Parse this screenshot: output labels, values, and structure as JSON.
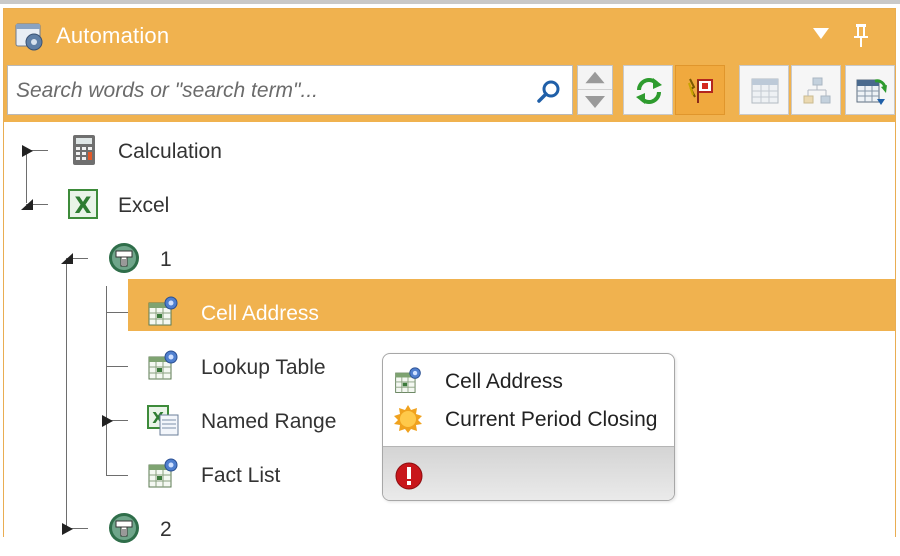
{
  "panel": {
    "title": "Automation"
  },
  "search": {
    "placeholder": "Search words or \"search term\"..."
  },
  "toolbar": {
    "buttons": [
      {
        "icon": "refresh-icon",
        "state": "normal"
      },
      {
        "icon": "flag-filter-icon",
        "state": "active"
      },
      {
        "icon": "table-grid-icon",
        "state": "disabled"
      },
      {
        "icon": "hierarchy-icon",
        "state": "disabled"
      },
      {
        "icon": "table-export-icon",
        "state": "normal"
      }
    ]
  },
  "tree": {
    "nodes": [
      {
        "label": "Calculation",
        "icon": "calculator-icon",
        "level": 0,
        "expanded": false
      },
      {
        "label": "Excel",
        "icon": "excel-icon",
        "level": 0,
        "expanded": true
      },
      {
        "label": "1",
        "icon": "connector-icon",
        "level": 1,
        "expanded": true
      },
      {
        "label": "Cell Address",
        "icon": "cell-address-icon",
        "level": 2,
        "selected": true
      },
      {
        "label": "Lookup Table",
        "icon": "lookup-table-icon",
        "level": 2
      },
      {
        "label": "Named Range",
        "icon": "named-range-icon",
        "level": 2,
        "expanded": false
      },
      {
        "label": "Fact List",
        "icon": "fact-list-icon",
        "level": 2
      },
      {
        "label": "2",
        "icon": "connector-icon",
        "level": 1,
        "expanded": false
      }
    ]
  },
  "popup": {
    "items": [
      {
        "label": "Cell Address",
        "icon": "cell-address-icon"
      },
      {
        "label": "Current Period Closing",
        "icon": "sun-badge-icon"
      }
    ],
    "footer_icon": "error-icon"
  },
  "colors": {
    "accent": "#f0b24f",
    "selection": "#f0b24f",
    "tree_line": "#6e6e6e",
    "error": "#d11a1a"
  }
}
